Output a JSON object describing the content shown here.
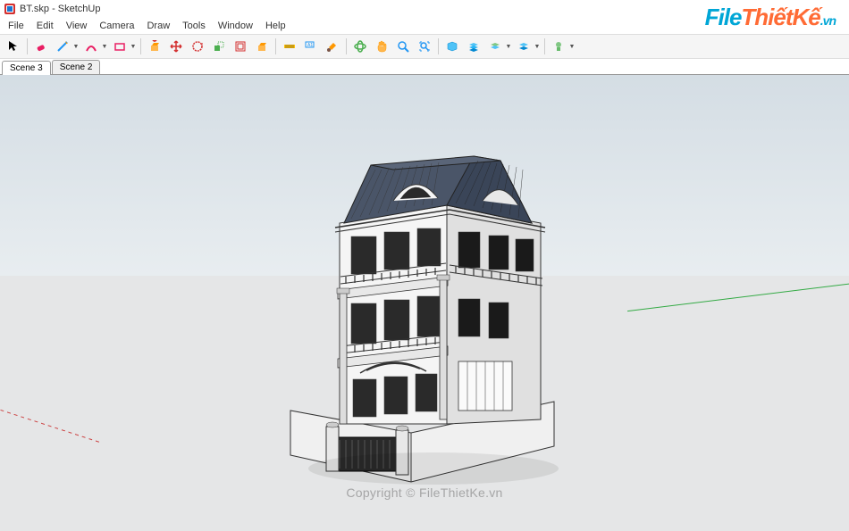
{
  "window": {
    "title": "BT.skp - SketchUp",
    "app_name": "SketchUp"
  },
  "menu": {
    "items": [
      "File",
      "Edit",
      "View",
      "Camera",
      "Draw",
      "Tools",
      "Window",
      "Help"
    ]
  },
  "toolbar": {
    "groups": [
      {
        "id": "select",
        "tools": [
          {
            "name": "select-tool",
            "color": "#000"
          }
        ]
      },
      {
        "id": "modify1",
        "tools": [
          {
            "name": "eraser-tool",
            "color": "#e91e63"
          },
          {
            "name": "line-tool",
            "color": "#2196f3"
          },
          {
            "name": "arc-tool",
            "color": "#e91e63"
          },
          {
            "name": "rectangle-tool",
            "color": "#e91e63"
          }
        ]
      },
      {
        "id": "transform",
        "tools": [
          {
            "name": "pushpull-tool",
            "color": "#ff9800"
          },
          {
            "name": "move-tool",
            "color": "#f44336"
          },
          {
            "name": "rotate-tool",
            "color": "#f44336"
          },
          {
            "name": "scale-tool",
            "color": "#4caf50"
          },
          {
            "name": "offset-tool",
            "color": "#f44336"
          },
          {
            "name": "followme-tool",
            "color": "#ff9800"
          }
        ]
      },
      {
        "id": "annotate",
        "tools": [
          {
            "name": "tape-tool",
            "color": "#ff9800"
          },
          {
            "name": "text-tool",
            "color": "#2196f3"
          },
          {
            "name": "paint-tool",
            "color": "#ff9800"
          }
        ]
      },
      {
        "id": "view",
        "tools": [
          {
            "name": "orbit-tool",
            "color": "#4caf50"
          },
          {
            "name": "pan-tool",
            "color": "#ff9800"
          },
          {
            "name": "zoom-tool",
            "color": "#2196f3"
          },
          {
            "name": "zoom-extents-tool",
            "color": "#2196f3"
          }
        ]
      },
      {
        "id": "layers",
        "tools": [
          {
            "name": "section-tool",
            "color": "#2196f3"
          },
          {
            "name": "layers-tool",
            "color": "#2196f3"
          },
          {
            "name": "outliner-tool",
            "color": "#2196f3"
          },
          {
            "name": "scenes-tool",
            "color": "#2196f3"
          }
        ]
      },
      {
        "id": "extra",
        "tools": [
          {
            "name": "warehouse-tool",
            "color": "#4caf50"
          }
        ]
      }
    ]
  },
  "scenes": {
    "tabs": [
      {
        "label": "Scene 3",
        "active": true
      },
      {
        "label": "Scene 2",
        "active": false
      }
    ]
  },
  "watermark": {
    "logo_file": "File",
    "logo_thiet": "ThiếtKế",
    "logo_vn": ".vn",
    "copyright": "Copyright © FileThietKe.vn"
  },
  "viewport": {
    "model_name": "BT",
    "axis_colors": {
      "x": "#c44",
      "y": "#3a4",
      "z": "#44c"
    }
  }
}
